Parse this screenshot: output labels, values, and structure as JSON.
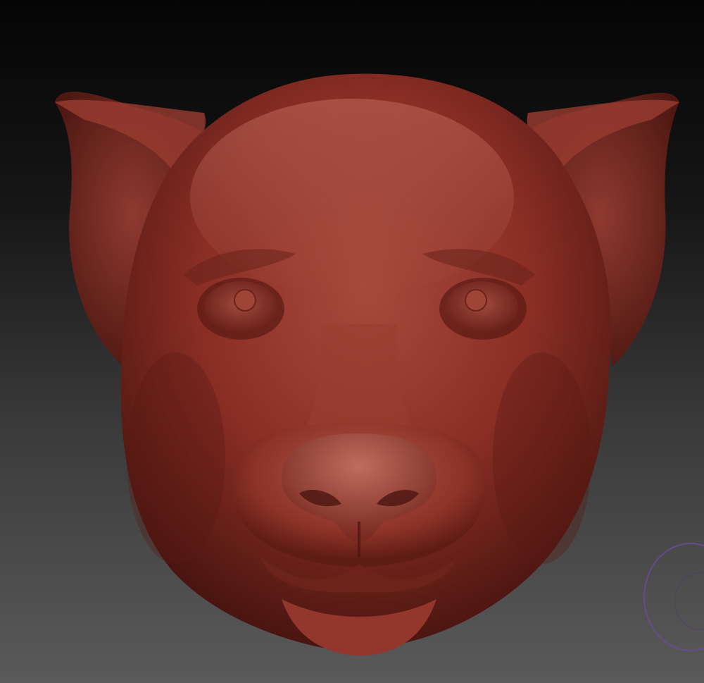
{
  "viewport": {
    "background_top": "#050505",
    "background_bottom": "#5a5a5a"
  },
  "model": {
    "name_icon": "sculpted-feline-head-icon",
    "material_color": "#8a2e24",
    "highlight_color": "#b0574a",
    "shadow_color": "#3e120e"
  },
  "gizmo": {
    "icon": "rotation-gizmo-icon",
    "color": "#6a4a9a"
  }
}
